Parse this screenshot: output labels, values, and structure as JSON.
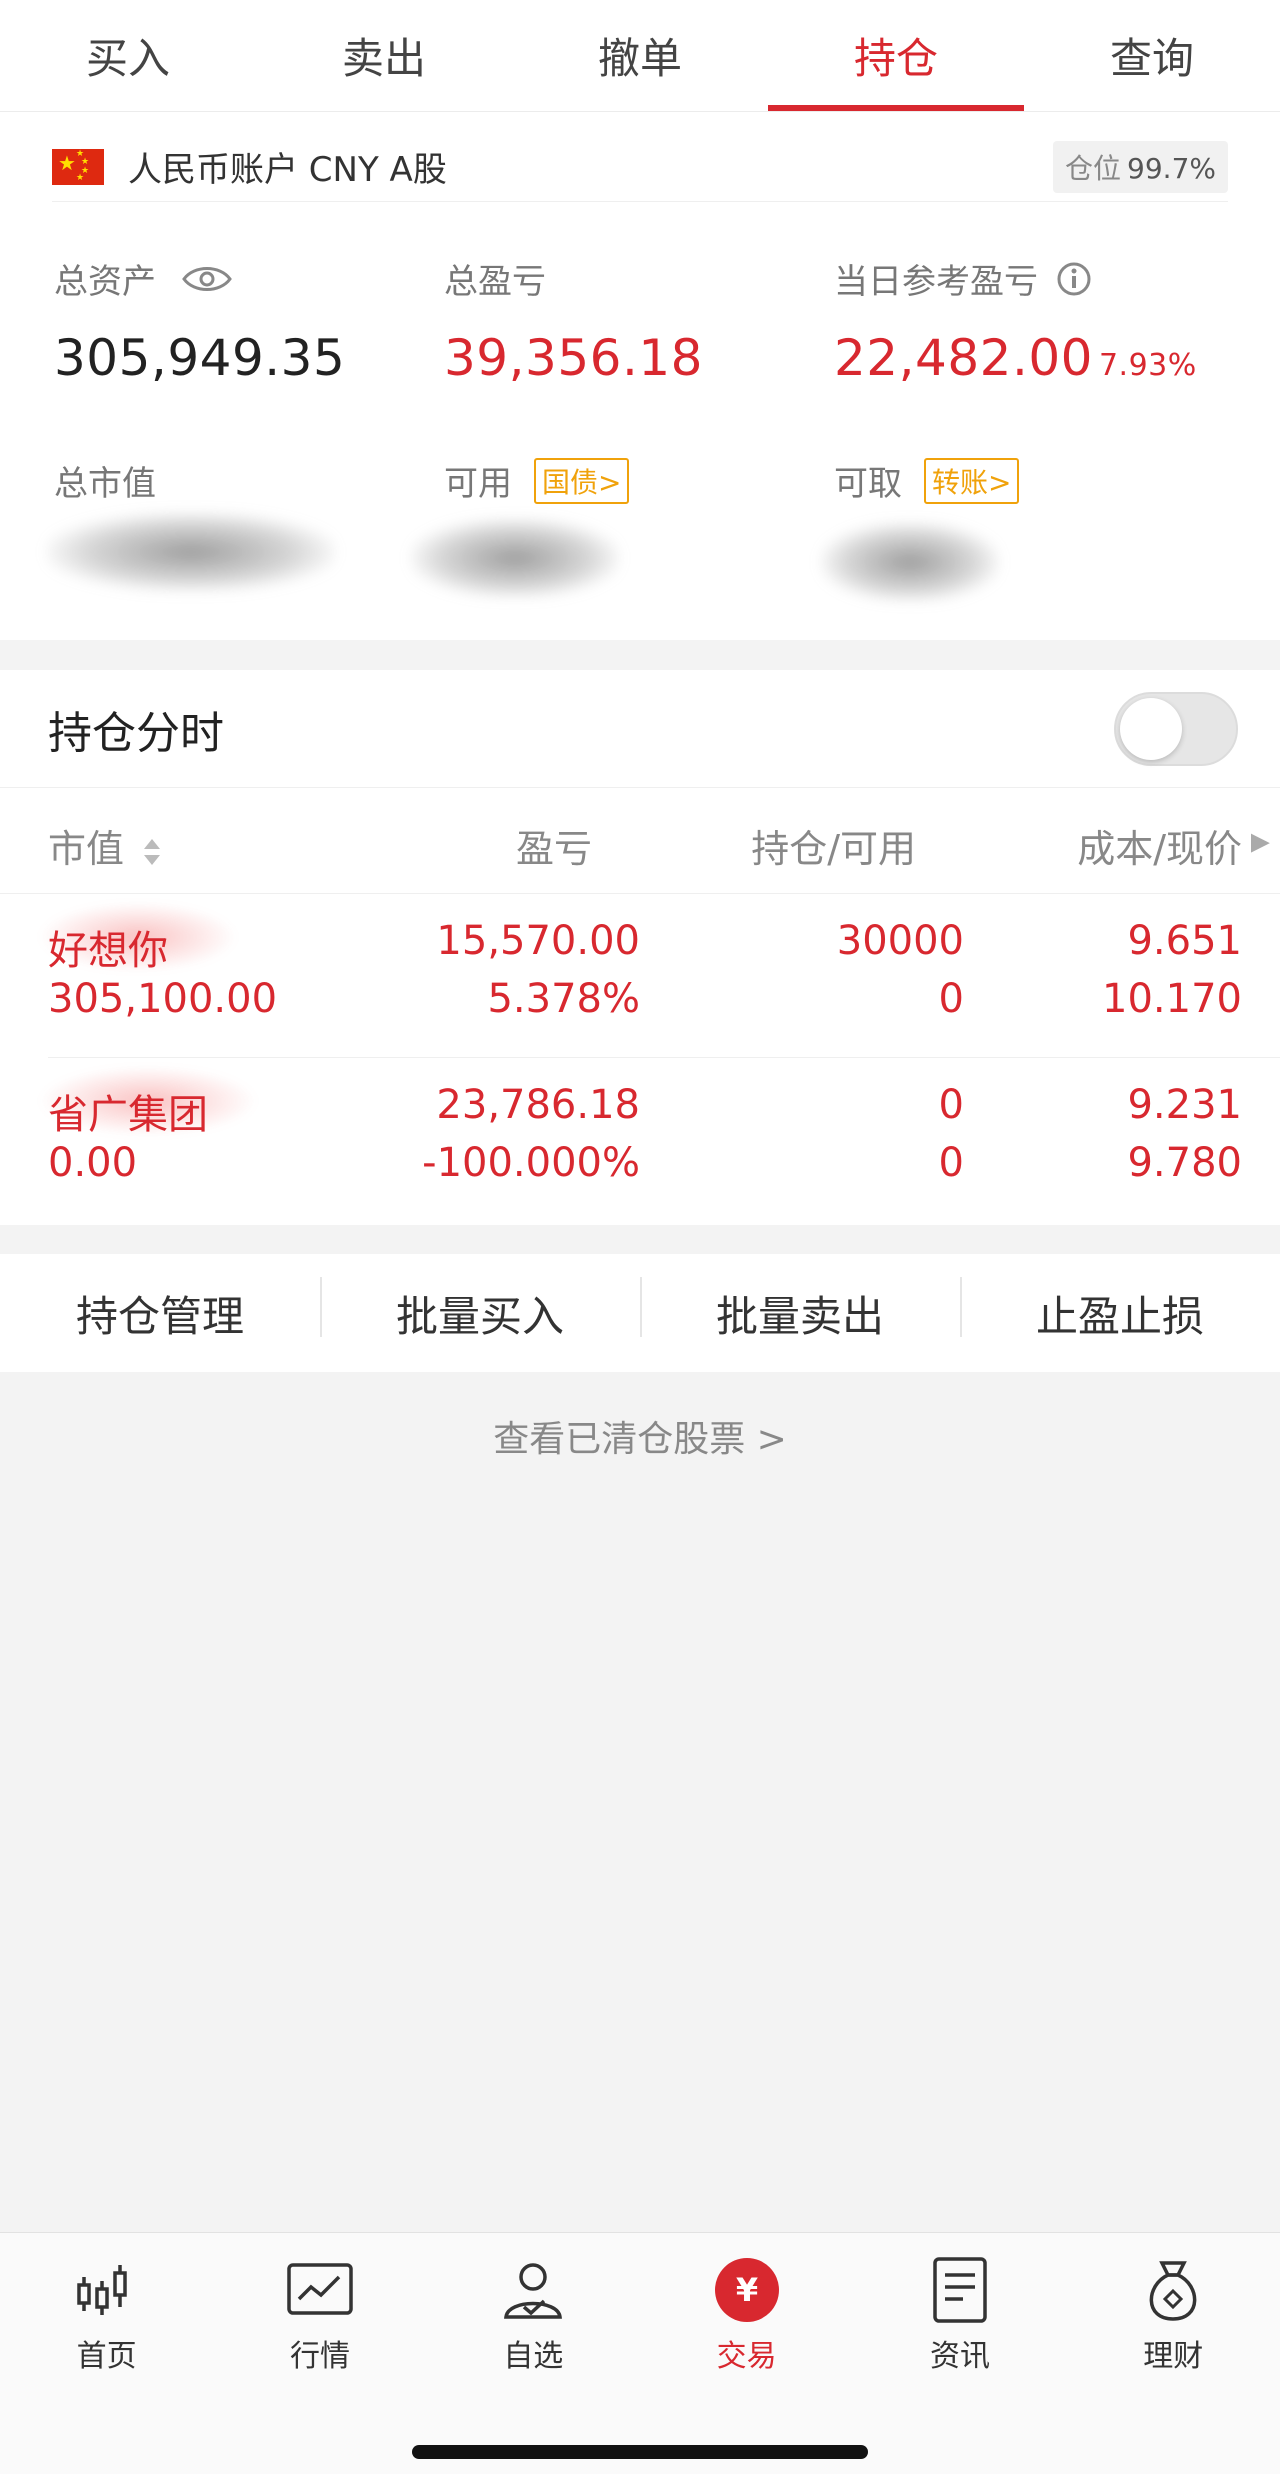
{
  "tabs": [
    {
      "label": "买入"
    },
    {
      "label": "卖出"
    },
    {
      "label": "撤单"
    },
    {
      "label": "持仓",
      "active": true
    },
    {
      "label": "查询"
    }
  ],
  "account": {
    "name": "人民币账户 CNY A股",
    "position_label": "仓位",
    "position_value": "99.7%"
  },
  "stats": {
    "total_assets_label": "总资产",
    "total_assets_value": "305,949.35",
    "total_pl_label": "总盈亏",
    "total_pl_value": "39,356.18",
    "daily_pl_label": "当日参考盈亏",
    "daily_pl_value": "22,482.00",
    "daily_pl_pct": "7.93%",
    "market_value_label": "总市值",
    "available_label": "可用",
    "available_tag": "国债>",
    "withdrawable_label": "可取",
    "withdrawable_tag": "转账>"
  },
  "holdings": {
    "title": "持仓分时",
    "toggle_on": false,
    "columns": {
      "market_value": "市值",
      "pl": "盈亏",
      "position": "持仓/可用",
      "cost": "成本/现价"
    },
    "rows": [
      {
        "name": "好想你",
        "market_value": "305,100.00",
        "pl": "15,570.00",
        "pl_pct": "5.378%",
        "position": "30000",
        "available": "0",
        "cost": "9.651",
        "price": "10.170"
      },
      {
        "name": "省广集团",
        "market_value": "0.00",
        "pl": "23,786.18",
        "pl_pct": "-100.000%",
        "position": "0",
        "available": "0",
        "cost": "9.231",
        "price": "9.780"
      }
    ]
  },
  "actions": [
    {
      "label": "持仓管理"
    },
    {
      "label": "批量买入"
    },
    {
      "label": "批量卖出"
    },
    {
      "label": "止盈止损"
    }
  ],
  "cleared_link": "查看已清仓股票 >",
  "bottom_nav": [
    {
      "label": "首页",
      "icon": "candlestick-icon"
    },
    {
      "label": "行情",
      "icon": "chart-icon"
    },
    {
      "label": "自选",
      "icon": "user-check-icon"
    },
    {
      "label": "交易",
      "icon": "yuan-icon",
      "active": true
    },
    {
      "label": "资讯",
      "icon": "document-icon"
    },
    {
      "label": "理财",
      "icon": "money-bag-icon"
    }
  ],
  "colors": {
    "accent": "#d8282f",
    "tag": "#f0a20b"
  }
}
